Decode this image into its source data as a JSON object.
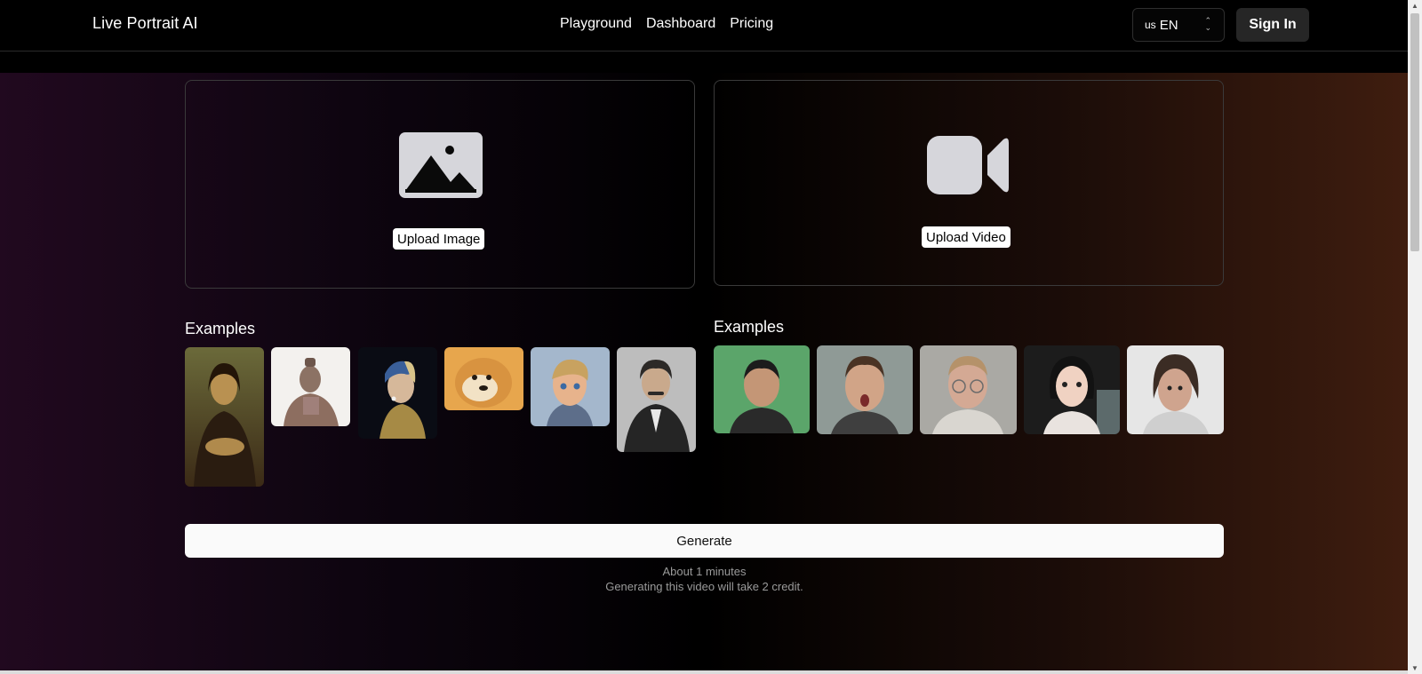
{
  "header": {
    "brand": "Live Portrait AI",
    "nav": [
      "Playground",
      "Dashboard",
      "Pricing"
    ],
    "lang_flag": "us",
    "lang_code": "EN",
    "signin": "Sign In"
  },
  "upload": {
    "image_label": "Upload Image",
    "video_label": "Upload Video",
    "image_icon": "image-icon",
    "video_icon": "video-camera-icon"
  },
  "examples": {
    "image_title": "Examples",
    "video_title": "Examples",
    "image_items": [
      "mona-lisa",
      "terracotta-warrior",
      "girl-with-pearl-earring",
      "doge",
      "cartoon-boy",
      "einstein"
    ],
    "video_items": [
      "man-green-screen",
      "man-surprised",
      "man-glasses",
      "woman-studio",
      "woman-cross-eyed"
    ]
  },
  "generate": {
    "label": "Generate",
    "note_time": "About 1 minutes",
    "note_credit": "Generating this video will take 2 credit."
  },
  "colors": {
    "gradient_left": "#21091f",
    "gradient_right": "#3f1d0f",
    "generate_bg": "#fafafa"
  }
}
